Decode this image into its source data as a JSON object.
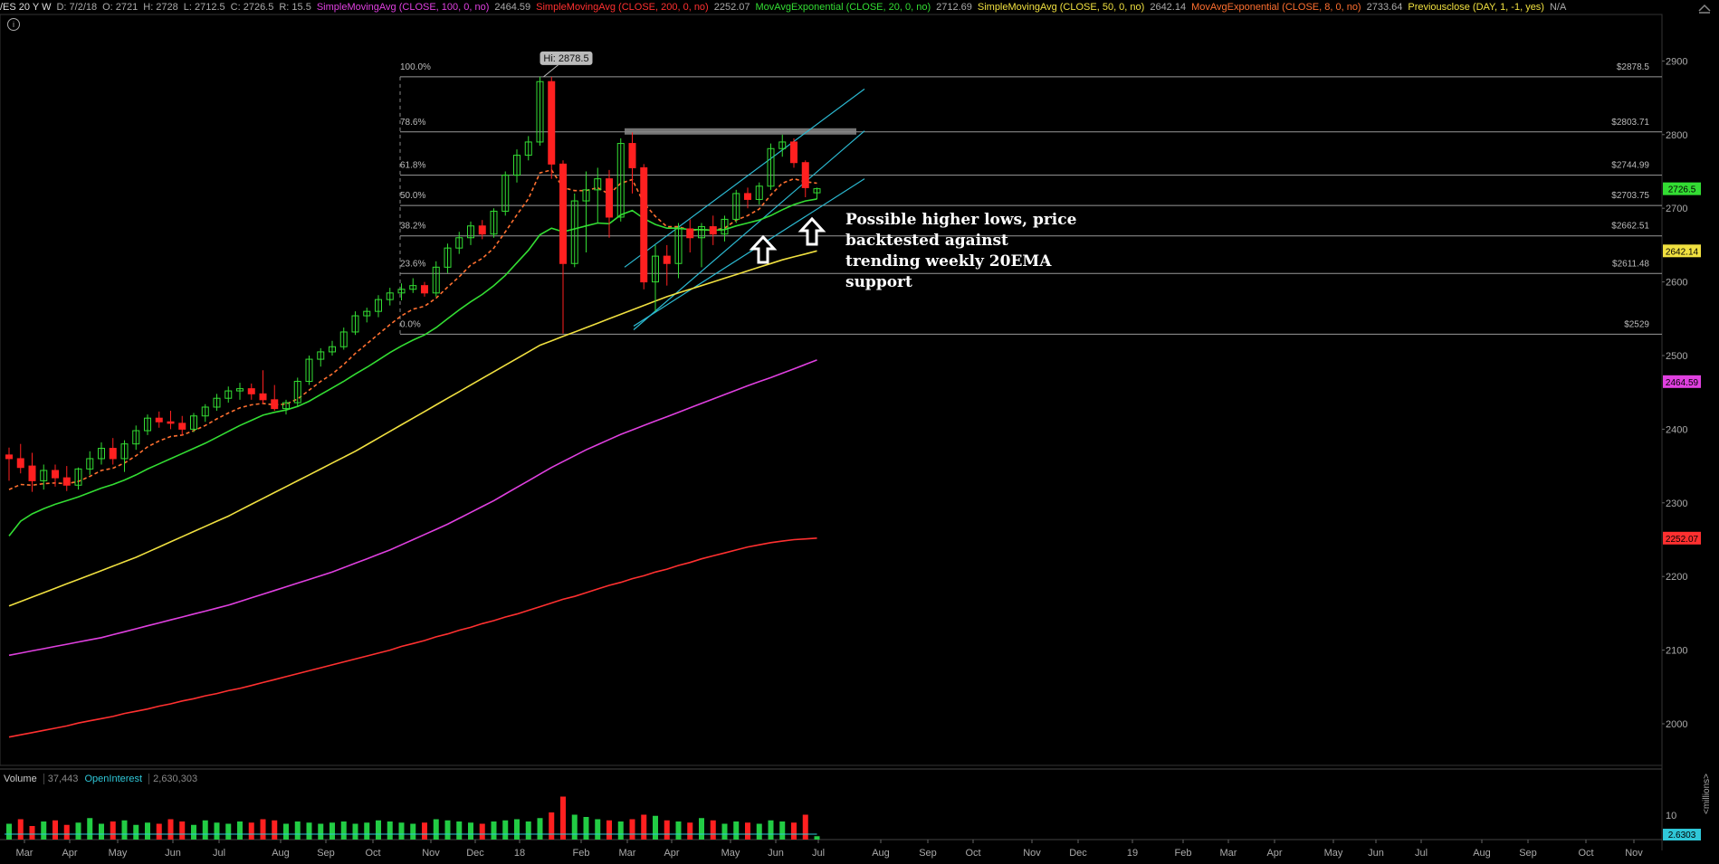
{
  "header": {
    "symbol": "/ES 20 Y W",
    "date": "D: 7/2/18",
    "open": "O: 2721",
    "high": "H: 2728",
    "low": "L: 2712.5",
    "close": "C: 2726.5",
    "range": "R: 15.5",
    "studies": [
      {
        "label": "SimpleMovingAvg (CLOSE, 100, 0, no)",
        "value": "2464.59",
        "color": "#e040e0"
      },
      {
        "label": "SimpleMovingAvg (CLOSE, 200, 0, no)",
        "value": "2252.07",
        "color": "#ff3030"
      },
      {
        "label": "MovAvgExponential (CLOSE, 20, 0, no)",
        "value": "2712.69",
        "color": "#33dd33"
      },
      {
        "label": "SimpleMovingAvg (CLOSE, 50, 0, no)",
        "value": "2642.14",
        "color": "#f0e040"
      },
      {
        "label": "MovAvgExponential (CLOSE, 8, 0, no)",
        "value": "2733.64",
        "color": "#ff7030"
      },
      {
        "label": "Previousclose (DAY, 1, -1, yes)",
        "value": "N/A",
        "color": "#f0e040"
      }
    ]
  },
  "info_icon": "i",
  "annotation": "Possible higher lows, price\nbacktested against\ntrending weekly 20EMA\nsupport",
  "volume_panel": {
    "volume_label": "Volume",
    "volume_value": "37,443",
    "oi_label": "OpenInterest",
    "oi_value": "2,630,303",
    "axis_tick": "10",
    "oi_badge": "2.6303",
    "units": "<millions>"
  },
  "chart_data": {
    "type": "candlestick",
    "title": "/ES 20 Y W",
    "ylim": [
      1945,
      2945
    ],
    "y_ticks": [
      2000,
      2100,
      2200,
      2300,
      2400,
      2500,
      2600,
      2700,
      2800,
      2900
    ],
    "x_ticks": [
      "Mar",
      "Apr",
      "May",
      "Jun",
      "Jul",
      "Aug",
      "Sep",
      "Oct",
      "Nov",
      "Dec",
      "18",
      "Feb",
      "Mar",
      "Apr",
      "May",
      "Jun",
      "Jul",
      "Aug",
      "Sep",
      "Oct",
      "Nov",
      "Dec",
      "19",
      "Feb",
      "Mar",
      "Apr",
      "May",
      "Jun",
      "Jul",
      "Aug",
      "Sep",
      "Oct",
      "Nov"
    ],
    "high_label": "Hi: 2878.5",
    "fib_levels": [
      {
        "pct": "100.0%",
        "price": 2878.5,
        "label": "$2878.5"
      },
      {
        "pct": "78.6%",
        "price": 2803.71,
        "label": "$2803.71"
      },
      {
        "pct": "61.8%",
        "price": 2744.99,
        "label": "$2744.99"
      },
      {
        "pct": "50.0%",
        "price": 2703.75,
        "label": "$2703.75"
      },
      {
        "pct": "38.2%",
        "price": 2662.51,
        "label": "$2662.51"
      },
      {
        "pct": "23.6%",
        "price": 2611.48,
        "label": "$2611.48"
      },
      {
        "pct": "0.0%",
        "price": 2529,
        "label": "$2529"
      }
    ],
    "price_badges": [
      {
        "value": "2726.5",
        "price": 2726.5,
        "color": "#33dd33"
      },
      {
        "value": "2642.14",
        "price": 2642.14,
        "color": "#f0e040"
      },
      {
        "value": "2464.59",
        "price": 2464.59,
        "color": "#e040e0"
      },
      {
        "value": "2252.07",
        "price": 2252.07,
        "color": "#ff3030"
      }
    ],
    "candles": [
      [
        2365,
        2375,
        2330,
        2360
      ],
      [
        2360,
        2380,
        2340,
        2348
      ],
      [
        2350,
        2368,
        2315,
        2330
      ],
      [
        2330,
        2352,
        2318,
        2344
      ],
      [
        2344,
        2352,
        2322,
        2334
      ],
      [
        2334,
        2350,
        2316,
        2324
      ],
      [
        2324,
        2348,
        2318,
        2346
      ],
      [
        2346,
        2370,
        2338,
        2360
      ],
      [
        2360,
        2382,
        2352,
        2374
      ],
      [
        2374,
        2388,
        2352,
        2360
      ],
      [
        2360,
        2385,
        2342,
        2380
      ],
      [
        2380,
        2405,
        2372,
        2398
      ],
      [
        2398,
        2420,
        2392,
        2415
      ],
      [
        2415,
        2424,
        2402,
        2410
      ],
      [
        2410,
        2425,
        2400,
        2408
      ],
      [
        2408,
        2418,
        2392,
        2400
      ],
      [
        2400,
        2422,
        2396,
        2418
      ],
      [
        2418,
        2434,
        2410,
        2430
      ],
      [
        2430,
        2448,
        2425,
        2442
      ],
      [
        2442,
        2458,
        2436,
        2452
      ],
      [
        2452,
        2463,
        2440,
        2455
      ],
      [
        2455,
        2462,
        2440,
        2448
      ],
      [
        2448,
        2480,
        2435,
        2440
      ],
      [
        2440,
        2460,
        2425,
        2428
      ],
      [
        2428,
        2440,
        2420,
        2436
      ],
      [
        2436,
        2470,
        2430,
        2465
      ],
      [
        2465,
        2500,
        2460,
        2495
      ],
      [
        2495,
        2510,
        2485,
        2505
      ],
      [
        2505,
        2520,
        2500,
        2512
      ],
      [
        2512,
        2538,
        2508,
        2532
      ],
      [
        2532,
        2560,
        2528,
        2554
      ],
      [
        2554,
        2565,
        2545,
        2560
      ],
      [
        2560,
        2582,
        2552,
        2576
      ],
      [
        2576,
        2592,
        2568,
        2585
      ],
      [
        2585,
        2598,
        2575,
        2590
      ],
      [
        2590,
        2605,
        2585,
        2595
      ],
      [
        2595,
        2600,
        2580,
        2585
      ],
      [
        2585,
        2628,
        2580,
        2620
      ],
      [
        2620,
        2652,
        2612,
        2646
      ],
      [
        2646,
        2668,
        2638,
        2660
      ],
      [
        2660,
        2682,
        2650,
        2676
      ],
      [
        2676,
        2684,
        2658,
        2665
      ],
      [
        2665,
        2700,
        2660,
        2696
      ],
      [
        2696,
        2750,
        2690,
        2745
      ],
      [
        2745,
        2780,
        2735,
        2772
      ],
      [
        2772,
        2798,
        2765,
        2790
      ],
      [
        2790,
        2878.5,
        2785,
        2872
      ],
      [
        2872,
        2878.5,
        2740,
        2760
      ],
      [
        2760,
        2765,
        2530,
        2625
      ],
      [
        2625,
        2720,
        2620,
        2710
      ],
      [
        2710,
        2750,
        2640,
        2725
      ],
      [
        2725,
        2755,
        2680,
        2740
      ],
      [
        2740,
        2752,
        2660,
        2688
      ],
      [
        2688,
        2795,
        2682,
        2788
      ],
      [
        2788,
        2803,
        2720,
        2755
      ],
      [
        2755,
        2760,
        2590,
        2600
      ],
      [
        2600,
        2650,
        2560,
        2635
      ],
      [
        2635,
        2650,
        2595,
        2625
      ],
      [
        2625,
        2680,
        2605,
        2672
      ],
      [
        2672,
        2685,
        2640,
        2660
      ],
      [
        2660,
        2680,
        2620,
        2675
      ],
      [
        2675,
        2690,
        2650,
        2665
      ],
      [
        2665,
        2690,
        2655,
        2685
      ],
      [
        2685,
        2725,
        2680,
        2720
      ],
      [
        2720,
        2728,
        2700,
        2712
      ],
      [
        2712,
        2735,
        2705,
        2730
      ],
      [
        2730,
        2788,
        2725,
        2781
      ],
      [
        2781,
        2800,
        2770,
        2790
      ],
      [
        2790,
        2795,
        2755,
        2762
      ],
      [
        2762,
        2765,
        2715,
        2728
      ],
      [
        2721,
        2728,
        2712.5,
        2726.5
      ]
    ],
    "series": [
      {
        "name": "MovAvgExponential (CLOSE, 8, 0, no)",
        "color": "#ff7030",
        "dashed": true,
        "values": [
          2318,
          2325,
          2324,
          2326,
          2327,
          2326,
          2329,
          2336,
          2344,
          2347,
          2354,
          2364,
          2376,
          2384,
          2390,
          2392,
          2398,
          2405,
          2414,
          2422,
          2429,
          2433,
          2435,
          2433,
          2434,
          2441,
          2453,
          2465,
          2475,
          2488,
          2503,
          2516,
          2529,
          2542,
          2554,
          2563,
          2567,
          2578,
          2593,
          2607,
          2623,
          2632,
          2646,
          2668,
          2691,
          2713,
          2748,
          2752,
          2728,
          2724,
          2724,
          2728,
          2719,
          2734,
          2739,
          2707,
          2689,
          2675,
          2675,
          2670,
          2671,
          2670,
          2673,
          2684,
          2690,
          2699,
          2718,
          2734,
          2740,
          2736,
          2734
        ]
      },
      {
        "name": "MovAvgExponential (CLOSE, 20, 0, no)",
        "color": "#33dd33",
        "values": [
          2255,
          2275,
          2285,
          2292,
          2298,
          2303,
          2308,
          2314,
          2320,
          2325,
          2331,
          2338,
          2346,
          2353,
          2360,
          2367,
          2374,
          2381,
          2389,
          2397,
          2405,
          2412,
          2419,
          2423,
          2426,
          2431,
          2438,
          2447,
          2456,
          2465,
          2475,
          2484,
          2494,
          2504,
          2513,
          2521,
          2528,
          2538,
          2550,
          2562,
          2573,
          2583,
          2595,
          2609,
          2626,
          2643,
          2664,
          2673,
          2668,
          2672,
          2676,
          2680,
          2679,
          2691,
          2697,
          2686,
          2678,
          2673,
          2673,
          2671,
          2671,
          2670,
          2671,
          2676,
          2680,
          2684,
          2690,
          2698,
          2705,
          2710,
          2712.69
        ]
      },
      {
        "name": "SimpleMovingAvg (CLOSE, 50, 0, no)",
        "color": "#f0e040",
        "values": [
          2160,
          2166,
          2172,
          2178,
          2184,
          2190,
          2196,
          2202,
          2208,
          2214,
          2220,
          2226,
          2233,
          2240,
          2247,
          2254,
          2261,
          2268,
          2275,
          2282,
          2290,
          2298,
          2306,
          2314,
          2322,
          2330,
          2338,
          2346,
          2354,
          2362,
          2370,
          2379,
          2388,
          2397,
          2406,
          2415,
          2424,
          2433,
          2442,
          2451,
          2460,
          2469,
          2478,
          2487,
          2496,
          2505,
          2514,
          2520,
          2526,
          2532,
          2538,
          2544,
          2550,
          2556,
          2562,
          2568,
          2574,
          2580,
          2585,
          2590,
          2595,
          2600,
          2605,
          2610,
          2615,
          2620,
          2625,
          2630,
          2634,
          2638,
          2642.14
        ]
      },
      {
        "name": "SimpleMovingAvg (CLOSE, 100, 0, no)",
        "color": "#e040e0",
        "values": [
          2093,
          2096,
          2099,
          2102,
          2105,
          2108,
          2111,
          2114,
          2117,
          2121,
          2125,
          2129,
          2133,
          2137,
          2141,
          2145,
          2149,
          2153,
          2157,
          2161,
          2166,
          2171,
          2176,
          2181,
          2186,
          2191,
          2196,
          2201,
          2206,
          2212,
          2218,
          2224,
          2230,
          2236,
          2243,
          2250,
          2257,
          2264,
          2271,
          2279,
          2287,
          2295,
          2303,
          2312,
          2321,
          2330,
          2339,
          2348,
          2356,
          2364,
          2372,
          2379,
          2386,
          2393,
          2399,
          2405,
          2411,
          2417,
          2423,
          2429,
          2435,
          2441,
          2447,
          2453,
          2459,
          2464.59,
          2470,
          2476,
          2482,
          2488,
          2494
        ]
      },
      {
        "name": "SimpleMovingAvg (CLOSE, 200, 0, no)",
        "color": "#ff3030",
        "values": [
          1982,
          1985,
          1988,
          1991,
          1994,
          1997,
          2001,
          2004,
          2007,
          2010,
          2014,
          2017,
          2020,
          2024,
          2027,
          2031,
          2034,
          2038,
          2041,
          2045,
          2048,
          2052,
          2056,
          2060,
          2064,
          2068,
          2072,
          2076,
          2080,
          2084,
          2088,
          2092,
          2096,
          2100,
          2105,
          2109,
          2113,
          2118,
          2122,
          2127,
          2131,
          2136,
          2140,
          2145,
          2149,
          2154,
          2159,
          2164,
          2169,
          2173,
          2178,
          2183,
          2188,
          2192,
          2197,
          2201,
          2206,
          2210,
          2215,
          2219,
          2224,
          2228,
          2232,
          2236,
          2240,
          2243,
          2246,
          2248,
          2250,
          2251,
          2252.07
        ]
      }
    ],
    "volume": [
      14,
      18,
      12,
      16,
      17,
      13,
      15,
      19,
      14,
      16,
      17,
      13,
      15,
      14,
      18,
      16,
      13,
      17,
      15,
      14,
      16,
      15,
      18,
      17,
      14,
      16,
      15,
      14,
      15,
      16,
      14,
      15,
      17,
      16,
      15,
      14,
      15,
      18,
      17,
      16,
      15,
      14,
      16,
      17,
      18,
      16,
      19,
      24,
      38,
      22,
      20,
      18,
      17,
      16,
      18,
      22,
      21,
      17,
      16,
      15,
      19,
      17,
      14,
      16,
      15,
      14,
      17,
      16,
      15,
      22,
      3
    ],
    "volume_up": [
      true,
      false,
      false,
      true,
      false,
      false,
      true,
      true,
      true,
      false,
      true,
      true,
      true,
      false,
      false,
      false,
      true,
      true,
      true,
      true,
      true,
      false,
      false,
      false,
      true,
      true,
      true,
      true,
      true,
      true,
      true,
      true,
      true,
      true,
      true,
      true,
      false,
      true,
      true,
      true,
      true,
      false,
      true,
      true,
      true,
      true,
      true,
      false,
      false,
      true,
      true,
      true,
      false,
      true,
      false,
      false,
      true,
      false,
      true,
      false,
      true,
      false,
      true,
      true,
      false,
      true,
      true,
      true,
      false,
      false,
      true
    ]
  }
}
